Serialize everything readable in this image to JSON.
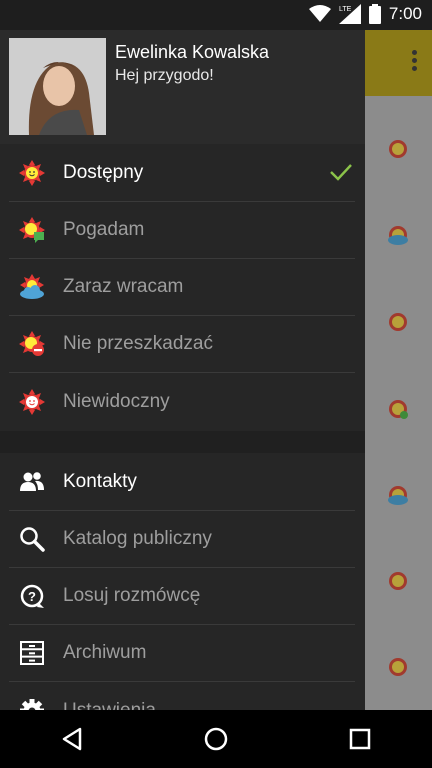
{
  "status_bar": {
    "time": "7:00",
    "icons": [
      "wifi-icon",
      "lte-signal-icon",
      "battery-icon"
    ],
    "network_label": "LTE"
  },
  "profile": {
    "name": "Ewelinka Kowalska",
    "status": "Hej przygodo!"
  },
  "presence": [
    {
      "label": "Dostępny",
      "icon": "sun-smile-icon",
      "selected": true
    },
    {
      "label": "Pogadam",
      "icon": "sun-chat-icon",
      "selected": false
    },
    {
      "label": "Zaraz wracam",
      "icon": "sun-cloud-icon",
      "selected": false
    },
    {
      "label": "Nie przeszkadzać",
      "icon": "sun-dnd-icon",
      "selected": false
    },
    {
      "label": "Niewidoczny",
      "icon": "sun-invisible-icon",
      "selected": false
    }
  ],
  "menu": [
    {
      "label": "Kontakty",
      "icon": "contacts-icon",
      "active": true
    },
    {
      "label": "Katalog publiczny",
      "icon": "search-icon",
      "active": false
    },
    {
      "label": "Losuj rozmówcę",
      "icon": "random-chat-icon",
      "active": false
    },
    {
      "label": "Archiwum",
      "icon": "archive-icon",
      "active": false
    },
    {
      "label": "Ustawienia",
      "icon": "gear-icon",
      "active": false
    }
  ],
  "colors": {
    "drawer_bg": "#2b2b2b",
    "accent_check": "#8bc34a",
    "appbar": "#f3d21f",
    "sun": "#e53935"
  }
}
